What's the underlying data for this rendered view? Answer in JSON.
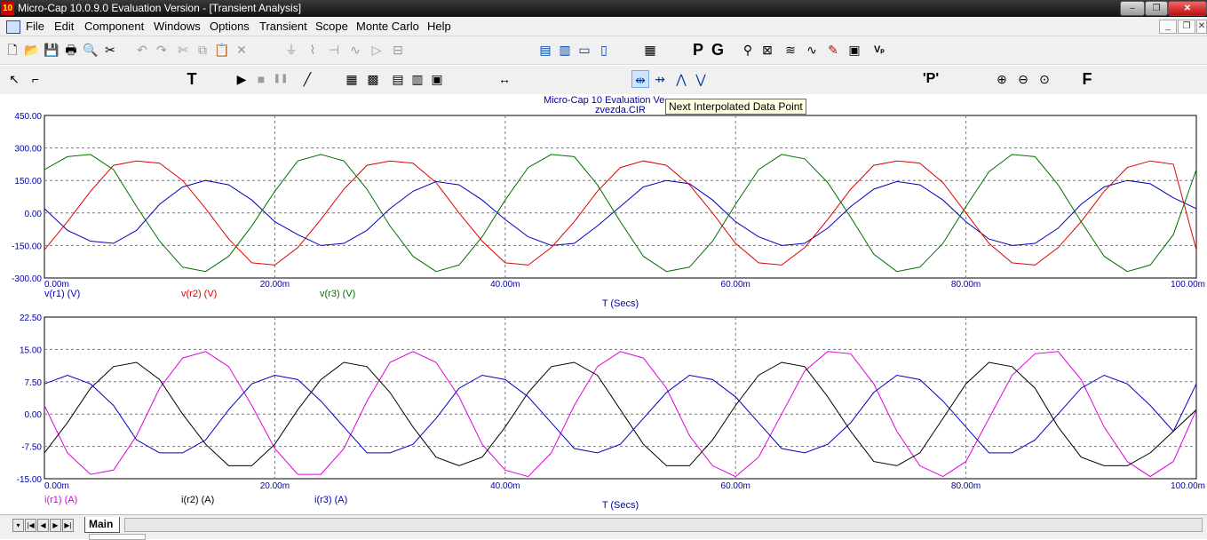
{
  "window": {
    "app_icon_text": "10",
    "title": "Micro-Cap 10.0.9.0 Evaluation Version - [Transient Analysis]",
    "minimize": "–",
    "restore": "❐",
    "close": "✕"
  },
  "menu": [
    "File",
    "Edit",
    "Component",
    "Windows",
    "Options",
    "Transient",
    "Scope",
    "Monte Carlo",
    "Help"
  ],
  "mdi_controls": {
    "minimize": "_",
    "restore": "❐",
    "close": "✕"
  },
  "toolbar1": {
    "new_icon": "🗋",
    "open_icon": "📂",
    "save_icon": "💾",
    "print_icon": "🖶",
    "preview_icon": "🔍",
    "cut_icon": "✂",
    "undo_icon": "↶",
    "redo_icon": "↷",
    "cut2_icon": "✄",
    "copy_icon": "⧉",
    "paste_icon": "📋",
    "delete_icon": "✕",
    "ground_icon": "⏚",
    "resistor_icon": "⌇",
    "capacitor_icon": "⊣",
    "inductor_icon": "∿",
    "diode_icon": "▷",
    "battery_icon": "⊟",
    "tile_icon": "▤",
    "cascade_icon": "▥",
    "win1_icon": "▭",
    "win2_icon": "▯",
    "calc_icon": "▦",
    "p_label": "P",
    "g_label": "G",
    "probe_icon": "⚲",
    "graph_icon": "⊠",
    "wave_icon": "≋",
    "sine_icon": "∿",
    "pen_icon": "✎",
    "chip_icon": "▣",
    "v_label": "Vₚ"
  },
  "toolbar2": {
    "select_icon": "↖",
    "wire_icon": "⌐",
    "text_label": "T",
    "run_icon": "▶",
    "stop_icon": "■",
    "pause_icon": "❚❚",
    "line_icon": "╱",
    "grid_icons": [
      "▦",
      "▩",
      "▤",
      "▥",
      "▣"
    ],
    "cursor_icon": "↔",
    "peak_icon": "⋀",
    "valley_icon": "⋁",
    "next_interp_icon": "⇹",
    "prev_interp_icon": "⇸",
    "F_label": "F",
    "P_label": "'P'",
    "zoom_in": "⊕",
    "zoom_out": "⊖",
    "zoom_fit": "⊙"
  },
  "tooltip": "Next Interpolated Data Point",
  "plot_header": {
    "title": "Micro-Cap 10 Evaluation Ve",
    "file": "zvezda.CIR"
  },
  "chart_data": [
    {
      "type": "line",
      "x": [
        0,
        0.002,
        0.004,
        0.006,
        0.008,
        0.01,
        0.012,
        0.014,
        0.016,
        0.018,
        0.02,
        0.022,
        0.024,
        0.026,
        0.028,
        0.03,
        0.032,
        0.034,
        0.036,
        0.038,
        0.04,
        0.042,
        0.044,
        0.046,
        0.048,
        0.05,
        0.052,
        0.054,
        0.056,
        0.058,
        0.06,
        0.062,
        0.064,
        0.066,
        0.068,
        0.07,
        0.072,
        0.074,
        0.076,
        0.078,
        0.08,
        0.082,
        0.084,
        0.086,
        0.088,
        0.09,
        0.092,
        0.094,
        0.096,
        0.098,
        0.1
      ],
      "series": [
        {
          "name": "v(r1) (V)",
          "color": "#0000c0",
          "values": [
            20,
            -80,
            -130,
            -140,
            -80,
            40,
            120,
            150,
            130,
            60,
            -40,
            -100,
            -150,
            -140,
            -80,
            20,
            100,
            145,
            130,
            60,
            -30,
            -110,
            -150,
            -140,
            -60,
            30,
            120,
            150,
            135,
            60,
            -40,
            -110,
            -150,
            -140,
            -70,
            30,
            110,
            145,
            130,
            60,
            -40,
            -120,
            -150,
            -140,
            -70,
            40,
            120,
            150,
            135,
            70,
            20
          ]
        },
        {
          "name": "v(r2) (V)",
          "color": "#e00000",
          "values": [
            -170,
            -40,
            100,
            220,
            240,
            230,
            150,
            20,
            -120,
            -230,
            -240,
            -160,
            -30,
            110,
            220,
            240,
            230,
            140,
            0,
            -130,
            -230,
            -240,
            -160,
            -40,
            100,
            210,
            240,
            220,
            130,
            0,
            -140,
            -230,
            -240,
            -160,
            -30,
            110,
            220,
            240,
            230,
            140,
            0,
            -140,
            -230,
            -240,
            -160,
            -40,
            100,
            210,
            240,
            225,
            -170
          ]
        },
        {
          "name": "v(r3) (V)",
          "color": "#007000",
          "values": [
            200,
            260,
            270,
            200,
            30,
            -130,
            -250,
            -270,
            -200,
            -60,
            100,
            240,
            270,
            240,
            110,
            -60,
            -200,
            -270,
            -240,
            -110,
            60,
            210,
            270,
            260,
            130,
            -40,
            -200,
            -270,
            -250,
            -130,
            40,
            200,
            270,
            250,
            140,
            -20,
            -190,
            -270,
            -250,
            -140,
            30,
            190,
            270,
            260,
            130,
            -40,
            -200,
            -270,
            -240,
            -100,
            200
          ]
        }
      ],
      "xlabel": "T (Secs)",
      "ylim": [
        -300,
        450
      ],
      "x_ticks": [
        "0.00m",
        "20.00m",
        "40.00m",
        "60.00m",
        "80.00m",
        "100.00m"
      ],
      "y_ticks": [
        "450.00",
        "300.00",
        "150.00",
        "0.00",
        "-150.00",
        "-300.00"
      ],
      "grid": true
    },
    {
      "type": "line",
      "x": [
        0,
        0.002,
        0.004,
        0.006,
        0.008,
        0.01,
        0.012,
        0.014,
        0.016,
        0.018,
        0.02,
        0.022,
        0.024,
        0.026,
        0.028,
        0.03,
        0.032,
        0.034,
        0.036,
        0.038,
        0.04,
        0.042,
        0.044,
        0.046,
        0.048,
        0.05,
        0.052,
        0.054,
        0.056,
        0.058,
        0.06,
        0.062,
        0.064,
        0.066,
        0.068,
        0.07,
        0.072,
        0.074,
        0.076,
        0.078,
        0.08,
        0.082,
        0.084,
        0.086,
        0.088,
        0.09,
        0.092,
        0.094,
        0.096,
        0.098,
        0.1
      ],
      "series": [
        {
          "name": "i(r1) (A)",
          "color": "#e000e0",
          "values": [
            2,
            -9,
            -14,
            -13,
            -5,
            6,
            13,
            14.5,
            11,
            2,
            -8,
            -14,
            -14,
            -8,
            3,
            12,
            14.5,
            12,
            4,
            -7,
            -13,
            -14.5,
            -9,
            2,
            11,
            14.5,
            13,
            6,
            -5,
            -12,
            -14.5,
            -10,
            0,
            10,
            14.5,
            14,
            7,
            -4,
            -12,
            -14.5,
            -11,
            -1,
            9,
            14,
            14.5,
            8,
            -3,
            -11,
            -14.5,
            -11,
            1
          ]
        },
        {
          "name": "i(r2) (A)",
          "color": "#000000",
          "values": [
            -9,
            -2,
            6,
            11,
            12,
            8,
            0,
            -7,
            -12,
            -12,
            -7,
            1,
            8,
            12,
            11,
            5,
            -3,
            -10,
            -12,
            -10,
            -3,
            5,
            11,
            12,
            9,
            1,
            -7,
            -12,
            -12,
            -6,
            2,
            9,
            12,
            11,
            4,
            -4,
            -11,
            -12,
            -9,
            -1,
            7,
            12,
            11,
            6,
            -3,
            -10,
            -12,
            -12,
            -9,
            -4,
            1
          ]
        },
        {
          "name": "i(r3) (A)",
          "color": "#0000c0",
          "values": [
            7,
            9,
            7,
            2,
            -6,
            -9,
            -9,
            -6,
            1,
            7,
            9,
            8,
            3,
            -3,
            -9,
            -9,
            -7,
            -1,
            6,
            9,
            8,
            4,
            -2,
            -8,
            -9,
            -7,
            -1,
            5,
            9,
            8,
            4,
            -2,
            -8,
            -9,
            -7,
            -2,
            5,
            9,
            8,
            3,
            -3,
            -9,
            -9,
            -6,
            0,
            6,
            9,
            7,
            2,
            -4,
            7
          ]
        }
      ],
      "xlabel": "T (Secs)",
      "ylim": [
        -15,
        22.5
      ],
      "x_ticks": [
        "0.00m",
        "20.00m",
        "40.00m",
        "60.00m",
        "80.00m",
        "100.00m"
      ],
      "y_ticks": [
        "22.50",
        "15.00",
        "7.50",
        "0.00",
        "-7.50",
        "-15.00"
      ],
      "grid": true
    }
  ],
  "bottom": {
    "tab": "Main",
    "nav": [
      "▾",
      "|◀",
      "◀",
      "▶",
      "▶|"
    ]
  }
}
